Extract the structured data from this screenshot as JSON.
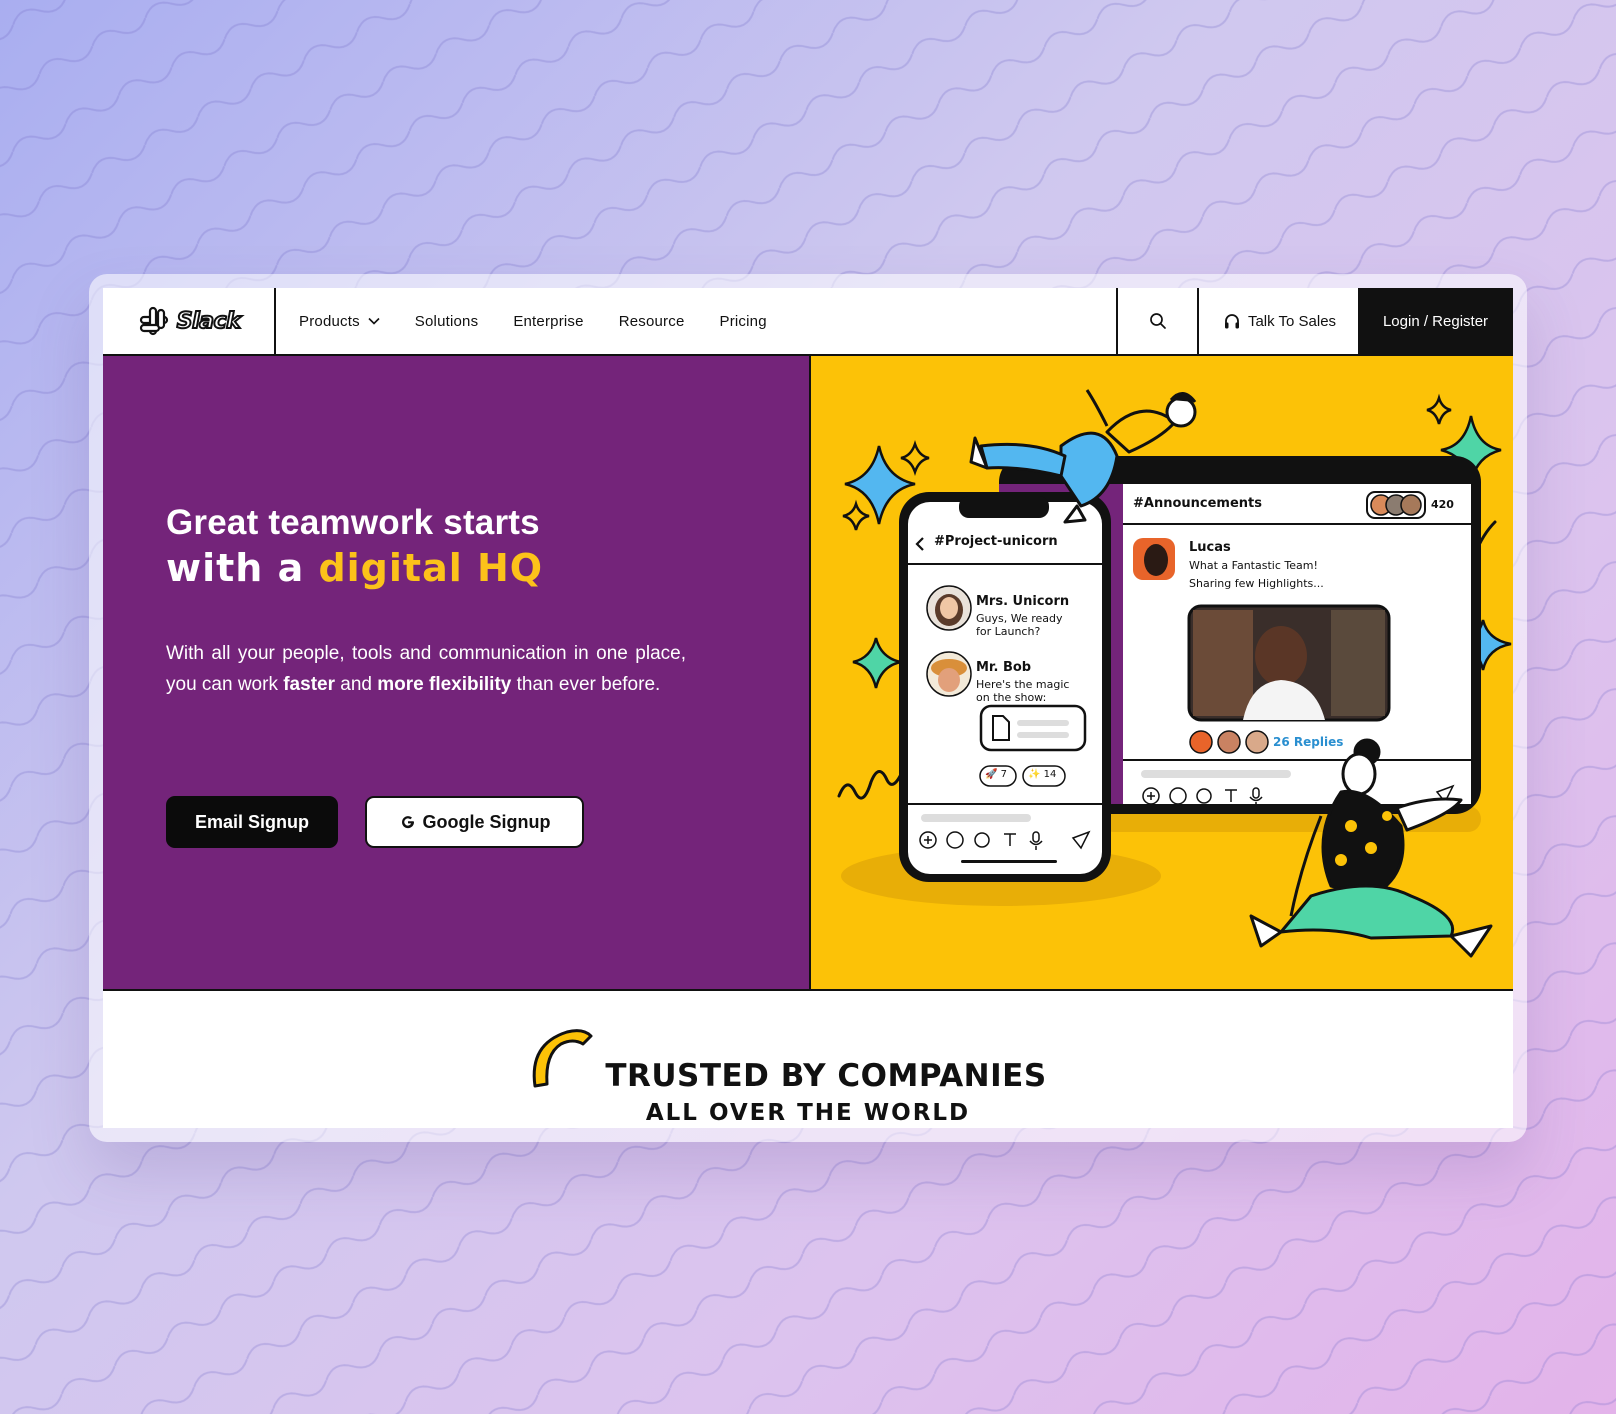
{
  "nav": {
    "logo_text": "Slack",
    "menu": [
      {
        "label": "Products",
        "has_dropdown": true
      },
      {
        "label": "Solutions"
      },
      {
        "label": "Enterprise"
      },
      {
        "label": "Resource"
      },
      {
        "label": "Pricing"
      }
    ],
    "talk_to_sales": "Talk To Sales",
    "login": "Login / Register"
  },
  "hero": {
    "title_line1": "Great teamwork starts",
    "title_line2_prefix": "with a ",
    "title_line2_highlight": "digital HQ",
    "description": {
      "p1": "With all your people, tools and communication in one place, you can work ",
      "b1": "faster",
      "p2": " and ",
      "b2": "more flexibility",
      "p3": " than ever before."
    },
    "email_signup": "Email Signup",
    "google_signup": "Google Signup"
  },
  "illustration": {
    "phone": {
      "channel": "#Project-unicorn",
      "messages": [
        {
          "name": "Mrs. Unicorn",
          "line1": "Guys, We ready",
          "line2": "for Launch?"
        },
        {
          "name": "Mr. Bob",
          "line1": "Here's the magic",
          "line2": "on the show:"
        }
      ],
      "reactions": [
        {
          "emoji": "🚀",
          "count": "7"
        },
        {
          "emoji": "✨",
          "count": "14"
        }
      ]
    },
    "tablet": {
      "channel": "#Announcements",
      "member_count": "420",
      "message": {
        "name": "Lucas",
        "line1": "What a Fantastic Team!",
        "line2": "Sharing few Highlights..."
      },
      "replies": "26 Replies"
    }
  },
  "trusted": {
    "line1": "TRUSTED BY COMPANIES",
    "line2": "ALL OVER THE WORLD"
  },
  "colors": {
    "hero_purple": "#74247a",
    "hero_yellow": "#fcc207",
    "highlight_yellow": "#fcc21a",
    "dark": "#111111"
  }
}
